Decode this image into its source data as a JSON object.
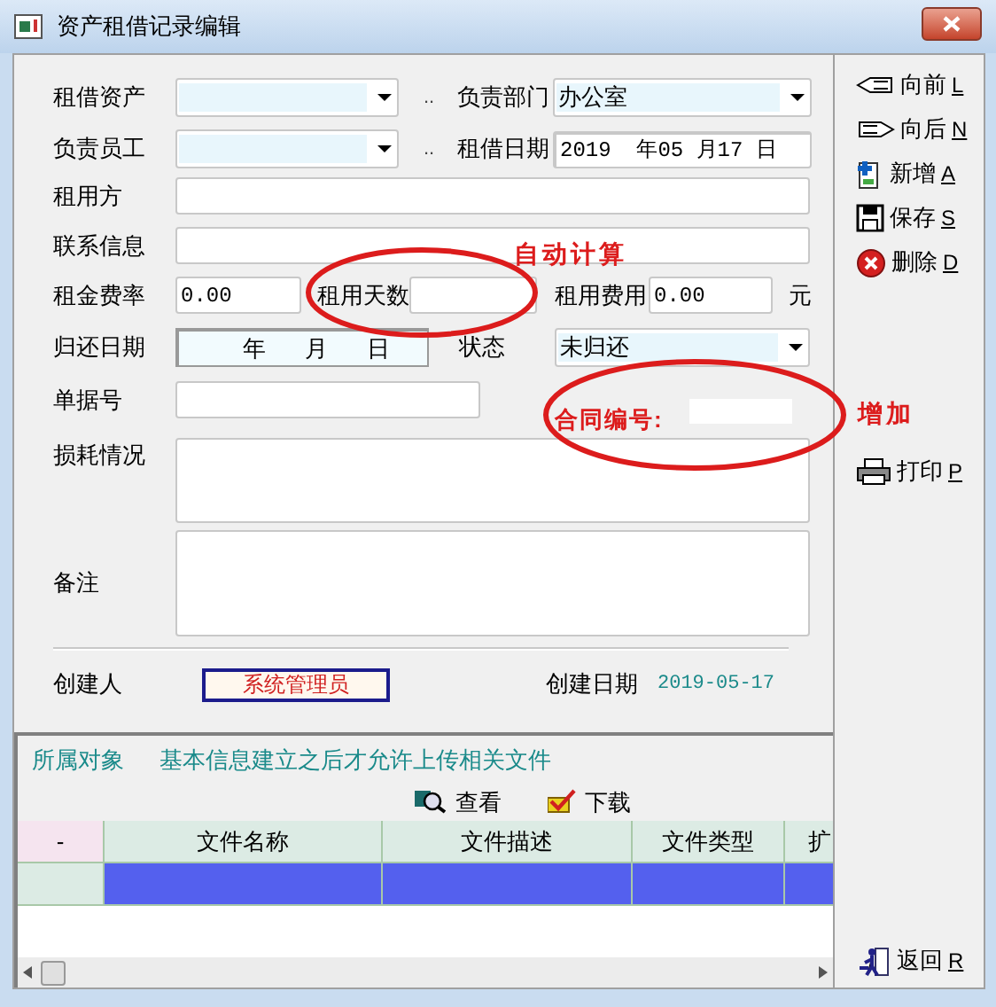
{
  "window": {
    "title": "资产租借记录编辑"
  },
  "form": {
    "asset": {
      "label": "租借资产",
      "more": ".."
    },
    "dept": {
      "label": "负责部门",
      "value": "办公室"
    },
    "employee": {
      "label": "负责员工",
      "more": ".."
    },
    "date": {
      "label": "租借日期",
      "value": "2019  年05 月17 日"
    },
    "renter": {
      "label": "租用方"
    },
    "contact": {
      "label": "联系信息"
    },
    "rate": {
      "label": "租金费率",
      "value": "0.00"
    },
    "days": {
      "label": "租用天数"
    },
    "cost": {
      "label": "租用费用",
      "value": "0.00",
      "unit": "元"
    },
    "return_date": {
      "label": "归还日期",
      "parts": [
        "年",
        "月",
        "日"
      ]
    },
    "status": {
      "label": "状态",
      "value": "未归还"
    },
    "doc_no": {
      "label": "单据号"
    },
    "loss": {
      "label": "损耗情况"
    },
    "note": {
      "label": "备注"
    },
    "creator": {
      "label": "创建人",
      "value": "系统管理员"
    },
    "created": {
      "label": "创建日期",
      "value": "2019-05-17"
    }
  },
  "annotations": {
    "auto_calc": "自动计算",
    "add": "增加",
    "contract_label": "合同编号:"
  },
  "toolbar": [
    {
      "label": "向前",
      "key": "L",
      "kind": "prev"
    },
    {
      "label": "向后",
      "key": "N",
      "kind": "next"
    },
    {
      "label": "新增",
      "key": "A",
      "kind": "new"
    },
    {
      "label": "保存",
      "key": "S",
      "kind": "save"
    },
    {
      "label": "删除",
      "key": "D",
      "kind": "delete"
    },
    {
      "label": "打印",
      "key": "P",
      "kind": "print"
    },
    {
      "label": "返回",
      "key": "R",
      "kind": "back"
    }
  ],
  "files": {
    "target_label": "所属对象",
    "hint": "基本信息建立之后才允许上传相关文件",
    "actions": [
      {
        "label": "查看",
        "kind": "view"
      },
      {
        "label": "下载",
        "kind": "download"
      }
    ],
    "columns": [
      "-",
      "文件名称",
      "文件描述",
      "文件类型",
      "扩"
    ],
    "rows": [
      {
        "selected": true
      }
    ]
  }
}
